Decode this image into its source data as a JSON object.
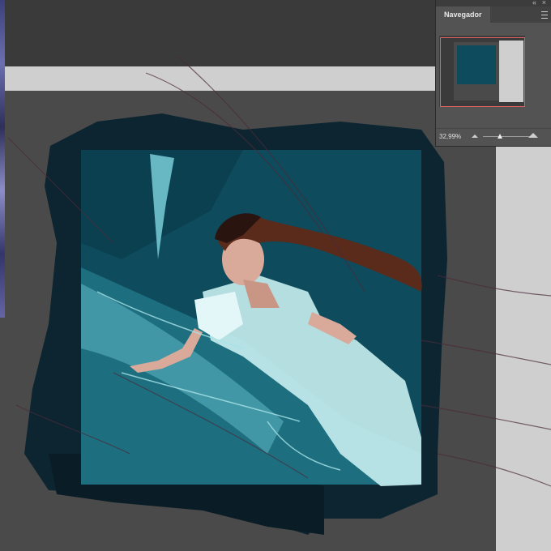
{
  "navigator": {
    "tab_label": "Navegador",
    "zoom_value": "32,99%",
    "zoom_level_percent": 32.99,
    "icons": {
      "collapse": "collapse-panels-icon",
      "close": "close-icon",
      "menu": "panel-menu-icon",
      "zoom_out": "zoom-out-icon",
      "zoom_in": "zoom-in-icon"
    },
    "view_rect_color": "#e06060"
  },
  "canvas": {
    "colors": {
      "frame_dark": "#0c2530",
      "art_teal": "#0e4b5c",
      "dress": "#c8eef0",
      "hair": "#5a2a1a",
      "skin": "#d9a99a",
      "pasteboard": "#cfcfcf"
    }
  }
}
